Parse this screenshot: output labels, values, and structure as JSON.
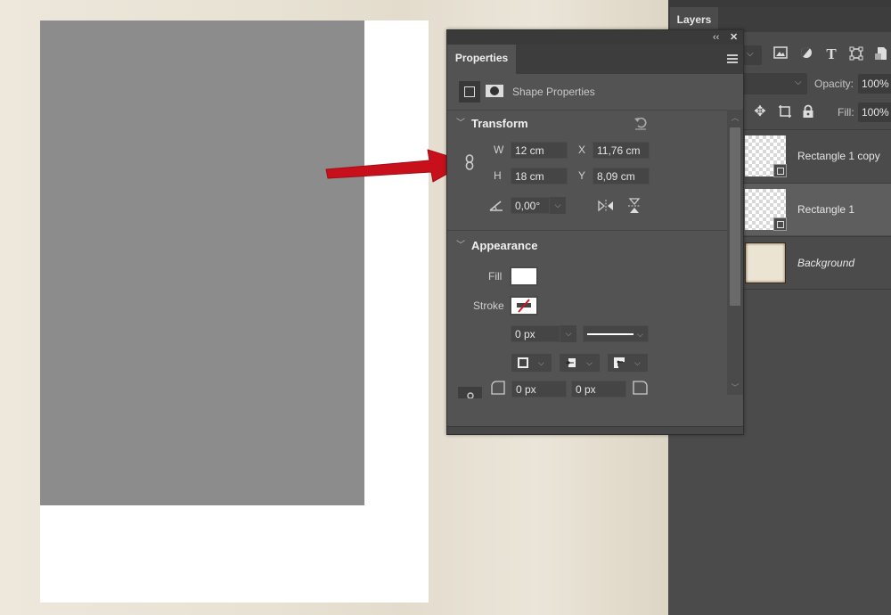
{
  "canvas": {
    "paper_color": "#ffffff",
    "rect_color": "#8c8c8c",
    "arrow_color": "#c8101c"
  },
  "layers_panel": {
    "tab_label": "Layers",
    "opacity_label": "Opacity:",
    "opacity_value": "100%",
    "fill_label": "Fill:",
    "fill_value": "100%",
    "filter_icons": [
      "image-filter-icon",
      "adjustment-filter-icon",
      "type-filter-icon",
      "shape-filter-icon",
      "smart-object-filter-icon"
    ],
    "lock_icons": [
      "lock-position-icon",
      "lock-artboard-icon",
      "lock-all-icon"
    ],
    "layers": [
      {
        "name": "Rectangle 1 copy",
        "type": "shape",
        "selected": false
      },
      {
        "name": "Rectangle 1",
        "type": "shape",
        "selected": true
      },
      {
        "name": "Background",
        "type": "background",
        "selected": false
      }
    ]
  },
  "properties_panel": {
    "tab_label": "Properties",
    "collapse_label": "‹‹",
    "close_label": "✕",
    "header_label": "Shape Properties",
    "transform": {
      "title": "Transform",
      "w_label": "W",
      "w_value": "12 cm",
      "h_label": "H",
      "h_value": "18 cm",
      "x_label": "X",
      "x_value": "11,76 cm",
      "y_label": "Y",
      "y_value": "8,09 cm",
      "angle_value": "0,00°"
    },
    "appearance": {
      "title": "Appearance",
      "fill_label": "Fill",
      "stroke_label": "Stroke",
      "stroke_width": "0 px",
      "corner_radius_1": "0 px",
      "corner_radius_2": "0 px"
    }
  }
}
